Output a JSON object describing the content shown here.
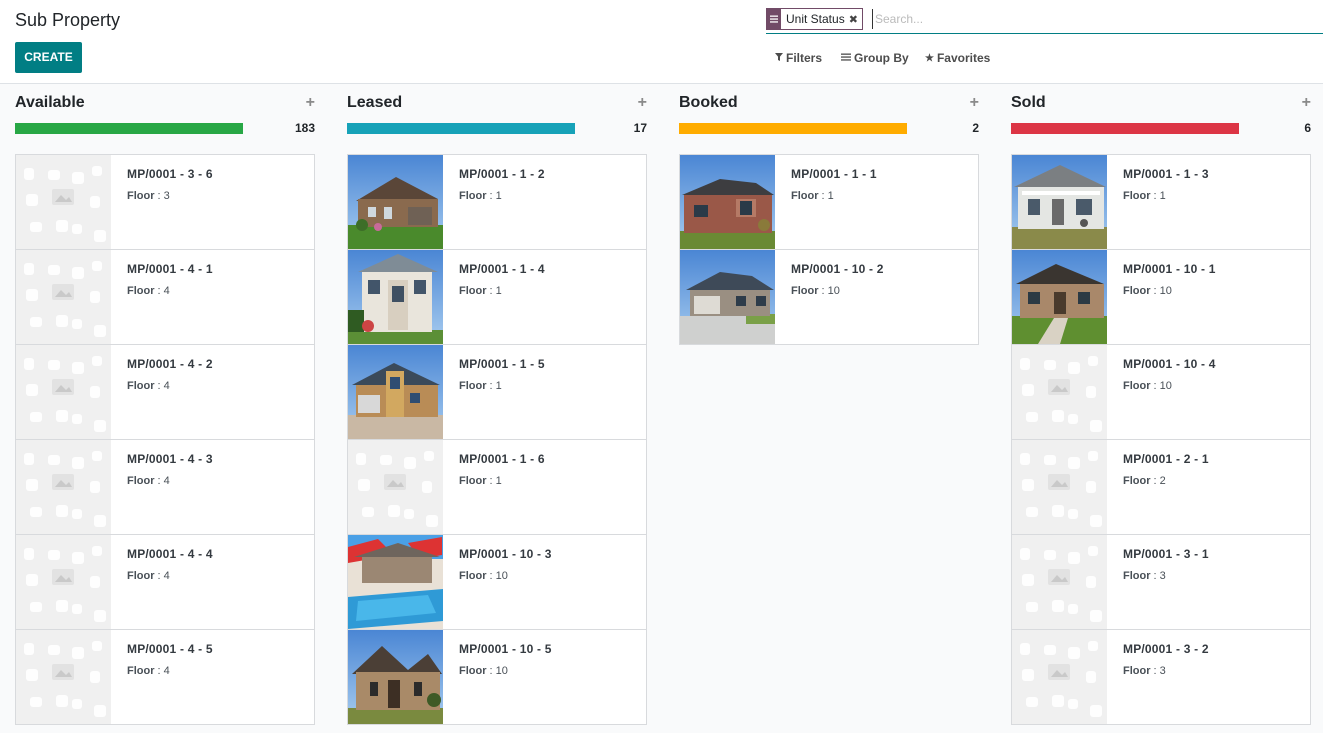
{
  "page": {
    "title": "Sub Property",
    "create_label": "CREATE"
  },
  "search": {
    "facet_label": "Unit Status",
    "placeholder": "Search...",
    "filters_label": "Filters",
    "groupby_label": "Group By",
    "favorites_label": "Favorites"
  },
  "columns": [
    {
      "name": "Available",
      "count": "183",
      "color": "#28a745",
      "cards": [
        {
          "name": "MP/0001 - 3 - 6",
          "floor_label": "Floor",
          "floor": "3",
          "image": "placeholder"
        },
        {
          "name": "MP/0001 - 4 - 1",
          "floor_label": "Floor",
          "floor": "4",
          "image": "placeholder"
        },
        {
          "name": "MP/0001 - 4 - 2",
          "floor_label": "Floor",
          "floor": "4",
          "image": "placeholder"
        },
        {
          "name": "MP/0001 - 4 - 3",
          "floor_label": "Floor",
          "floor": "4",
          "image": "placeholder"
        },
        {
          "name": "MP/0001 - 4 - 4",
          "floor_label": "Floor",
          "floor": "4",
          "image": "placeholder"
        },
        {
          "name": "MP/0001 - 4 - 5",
          "floor_label": "Floor",
          "floor": "4",
          "image": "placeholder"
        }
      ]
    },
    {
      "name": "Leased",
      "count": "17",
      "color": "#17a2b8",
      "cards": [
        {
          "name": "MP/0001 - 1 - 2",
          "floor_label": "Floor",
          "floor": "1",
          "image": "house-brick"
        },
        {
          "name": "MP/0001 - 1 - 4",
          "floor_label": "Floor",
          "floor": "1",
          "image": "house-white"
        },
        {
          "name": "MP/0001 - 1 - 5",
          "floor_label": "Floor",
          "floor": "1",
          "image": "house-tan"
        },
        {
          "name": "MP/0001 - 1 - 6",
          "floor_label": "Floor",
          "floor": "1",
          "image": "placeholder"
        },
        {
          "name": "MP/0001 - 10 - 3",
          "floor_label": "Floor",
          "floor": "10",
          "image": "pool"
        },
        {
          "name": "MP/0001 - 10 - 5",
          "floor_label": "Floor",
          "floor": "10",
          "image": "house-stone"
        }
      ]
    },
    {
      "name": "Booked",
      "count": "2",
      "color": "#ffac00",
      "cards": [
        {
          "name": "MP/0001 - 1 - 1",
          "floor_label": "Floor",
          "floor": "1",
          "image": "house-red"
        },
        {
          "name": "MP/0001 - 10 - 2",
          "floor_label": "Floor",
          "floor": "10",
          "image": "house-grey"
        }
      ]
    },
    {
      "name": "Sold",
      "count": "6",
      "color": "#dc3545",
      "cards": [
        {
          "name": "MP/0001 - 1 - 3",
          "floor_label": "Floor",
          "floor": "1",
          "image": "house-porch"
        },
        {
          "name": "MP/0001 - 10 - 1",
          "floor_label": "Floor",
          "floor": "10",
          "image": "house-path"
        },
        {
          "name": "MP/0001 - 10 - 4",
          "floor_label": "Floor",
          "floor": "10",
          "image": "placeholder"
        },
        {
          "name": "MP/0001 - 2 - 1",
          "floor_label": "Floor",
          "floor": "2",
          "image": "placeholder"
        },
        {
          "name": "MP/0001 - 3 - 1",
          "floor_label": "Floor",
          "floor": "3",
          "image": "placeholder"
        },
        {
          "name": "MP/0001 - 3 - 2",
          "floor_label": "Floor",
          "floor": "3",
          "image": "placeholder"
        }
      ]
    }
  ]
}
